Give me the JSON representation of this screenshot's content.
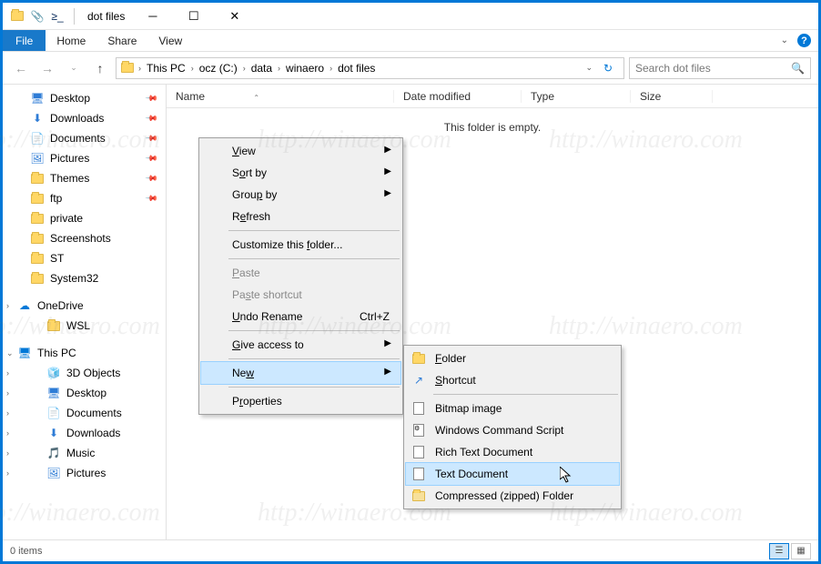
{
  "window": {
    "title": "dot files"
  },
  "ribbon": {
    "file": "File",
    "tabs": [
      "Home",
      "Share",
      "View"
    ]
  },
  "breadcrumb": {
    "segments": [
      "This PC",
      "ocz (C:)",
      "data",
      "winaero",
      "dot files"
    ]
  },
  "search": {
    "placeholder": "Search dot files"
  },
  "sidebar": {
    "quick": [
      {
        "label": "Desktop",
        "icon": "desktop",
        "pinned": true
      },
      {
        "label": "Downloads",
        "icon": "downloads",
        "pinned": true
      },
      {
        "label": "Documents",
        "icon": "documents",
        "pinned": true
      },
      {
        "label": "Pictures",
        "icon": "pictures",
        "pinned": true
      },
      {
        "label": "Themes",
        "icon": "folder",
        "pinned": true
      },
      {
        "label": "ftp",
        "icon": "folder",
        "pinned": true
      },
      {
        "label": "private",
        "icon": "folder",
        "pinned": false
      },
      {
        "label": "Screenshots",
        "icon": "folder",
        "pinned": false
      },
      {
        "label": "ST",
        "icon": "folder",
        "pinned": false
      },
      {
        "label": "System32",
        "icon": "folder",
        "pinned": false
      }
    ],
    "onedrive": "OneDrive",
    "wsl": "WSL",
    "thispc": "This PC",
    "pc_children": [
      {
        "label": "3D Objects",
        "icon": "3d"
      },
      {
        "label": "Desktop",
        "icon": "desktop"
      },
      {
        "label": "Documents",
        "icon": "documents"
      },
      {
        "label": "Downloads",
        "icon": "downloads"
      },
      {
        "label": "Music",
        "icon": "music"
      },
      {
        "label": "Pictures",
        "icon": "pictures"
      }
    ]
  },
  "columns": {
    "name": "Name",
    "date": "Date modified",
    "type": "Type",
    "size": "Size"
  },
  "content": {
    "empty": "This folder is empty."
  },
  "status": {
    "items": "0 items"
  },
  "context_menu": {
    "items": [
      {
        "label": "View",
        "submenu": true,
        "key": "V"
      },
      {
        "label": "Sort by",
        "submenu": true,
        "key": "o"
      },
      {
        "label": "Group by",
        "submenu": true,
        "key": "p"
      },
      {
        "label": "Refresh",
        "key": "e"
      },
      {
        "sep": true
      },
      {
        "label": "Customize this folder...",
        "key": "f"
      },
      {
        "sep": true
      },
      {
        "label": "Paste",
        "disabled": true,
        "key": "P"
      },
      {
        "label": "Paste shortcut",
        "disabled": true,
        "key": "s"
      },
      {
        "label": "Undo Rename",
        "shortcut": "Ctrl+Z",
        "key": "U"
      },
      {
        "sep": true
      },
      {
        "label": "Give access to",
        "submenu": true,
        "key": "G"
      },
      {
        "sep": true
      },
      {
        "label": "New",
        "submenu": true,
        "highlighted": true,
        "key": "w"
      },
      {
        "sep": true
      },
      {
        "label": "Properties",
        "key": "r"
      }
    ]
  },
  "submenu_new": {
    "items": [
      {
        "label": "Folder",
        "icon": "folder",
        "key": "F"
      },
      {
        "label": "Shortcut",
        "icon": "shortcut",
        "key": "S"
      },
      {
        "sep": true
      },
      {
        "label": "Bitmap image",
        "icon": "bitmap"
      },
      {
        "label": "Windows Command Script",
        "icon": "cmd"
      },
      {
        "label": "Rich Text Document",
        "icon": "rtf"
      },
      {
        "label": "Text Document",
        "icon": "txt",
        "highlighted": true
      },
      {
        "label": "Compressed (zipped) Folder",
        "icon": "zip"
      }
    ]
  },
  "watermark": "http://winaero.com"
}
